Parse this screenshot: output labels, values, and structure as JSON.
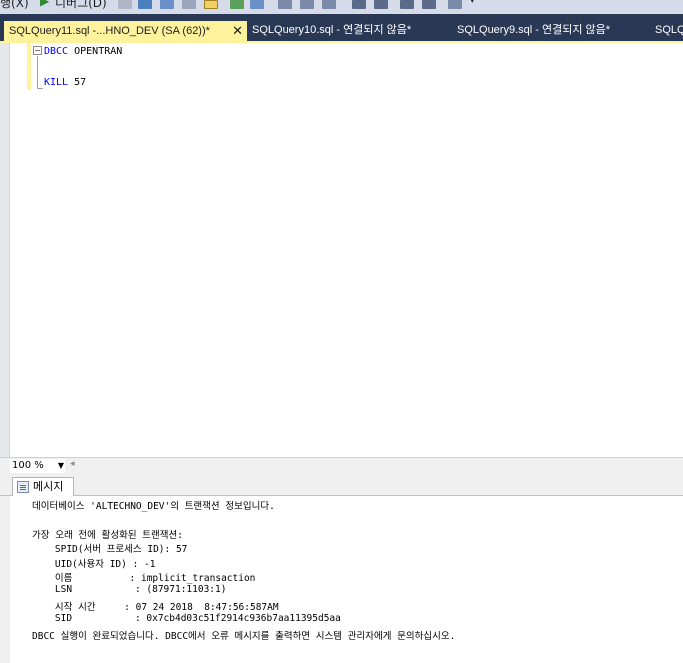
{
  "toolbar": {
    "execute_label": "디버그(D)",
    "partial_label": "행(X)"
  },
  "tabs": [
    {
      "label": "SQLQuery11.sql -...HNO_DEV (SA (62))*",
      "active": true
    },
    {
      "label": "SQLQuery10.sql - 연결되지 않음*",
      "active": false
    },
    {
      "label": "SQLQuery9.sql - 연결되지 않음*",
      "active": false
    },
    {
      "label": "SQLQ",
      "active": false
    }
  ],
  "editor": {
    "line1_keyword": "DBCC",
    "line1_rest": " OPENTRAN",
    "line3_keyword": "KILL",
    "line3_rest": " 57"
  },
  "zoom": {
    "value": "100 %"
  },
  "results": {
    "tab_label": "메시지",
    "lines": [
      "데이터베이스 'ALTECHNO_DEV'의 트랜잭션 정보입니다.",
      "",
      "가장 오래 전에 활성화된 트랜잭션:",
      "    SPID(서버 프로세스 ID): 57",
      "    UID(사용자 ID) : -1",
      "    이름          : implicit_transaction",
      "    LSN           : (87971:1103:1)",
      "    시작 시간     : 07 24 2018  8:47:56:587AM",
      "    SID           : 0x7cb4d03c51f2914c936b7aa11395d5aa",
      "DBCC 실행이 완료되었습니다. DBCC에서 오류 메시지를 출력하면 시스템 관리자에게 문의하십시오."
    ]
  },
  "colors": {
    "tabstrip_bg": "#293955",
    "active_tab_bg": "#fff29d",
    "keyword": "#0000ff"
  }
}
